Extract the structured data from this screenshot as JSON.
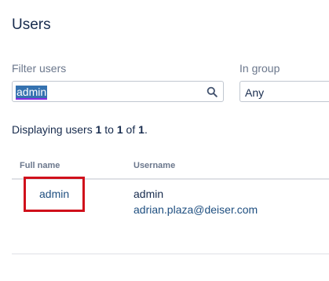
{
  "page": {
    "title": "Users"
  },
  "filter": {
    "label": "Filter users",
    "value": "admin",
    "icon": "search-icon"
  },
  "group": {
    "label": "In group",
    "selected": "Any"
  },
  "summary": {
    "prefix": "Displaying users ",
    "from": "1",
    "to_word": " to ",
    "to": "1",
    "of_word": " of ",
    "total": "1",
    "suffix": "."
  },
  "table": {
    "headers": {
      "full_name": "Full name",
      "username": "Username"
    },
    "rows": [
      {
        "full_name": "admin",
        "username": "admin",
        "email": "adrian.plaza@deiser.com"
      }
    ]
  },
  "colors": {
    "link": "#205081",
    "highlight": "#d0101b",
    "selection": "#3572b0"
  }
}
